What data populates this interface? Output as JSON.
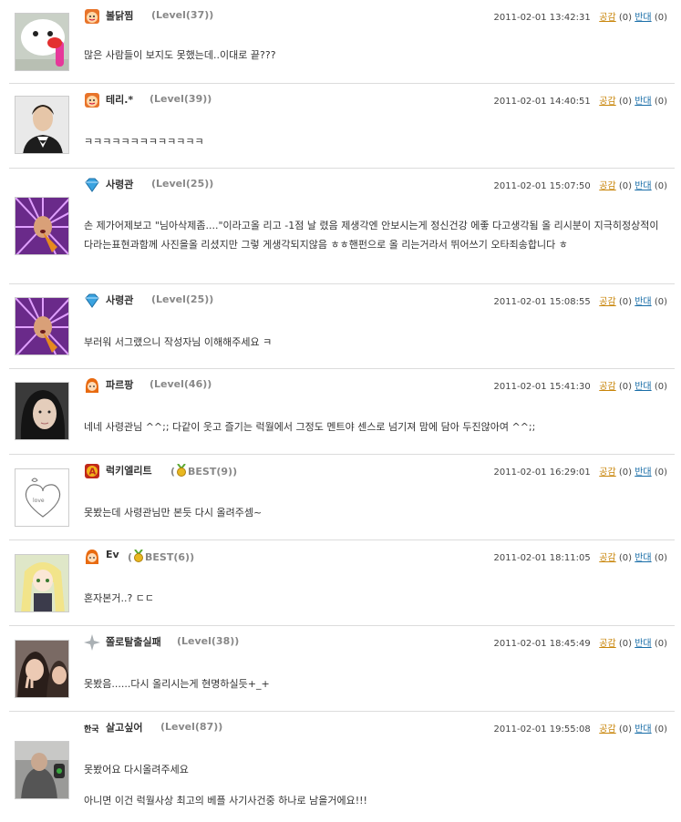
{
  "labels": {
    "agree": "공감",
    "oppose": "반대"
  },
  "comments": [
    {
      "nick": "볼닭찜",
      "level": "(Level(37))",
      "time": "2011-02-01 13:42:31",
      "agree_count": "(0)",
      "oppose_count": "(0)",
      "text": "많은 사람들이 보지도 못했는데..이대로 끝???",
      "level_icon": "orange-face-icon",
      "avatar": "white-ghost-avatar"
    },
    {
      "nick": "테리.*",
      "level": "(Level(39))",
      "time": "2011-02-01 14:40:51",
      "agree_count": "(0)",
      "oppose_count": "(0)",
      "text": "ㅋㅋㅋㅋㅋㅋㅋㅋㅋㅋㅋㅋㅋ",
      "level_icon": "orange-face-icon",
      "avatar": "man-in-suit-avatar"
    },
    {
      "nick": "사령관",
      "level": "(Level(25))",
      "time": "2011-02-01 15:07:50",
      "agree_count": "(0)",
      "oppose_count": "(0)",
      "text": "손 제가어제보고 \"님아삭제좀....\"이라고올 리고 -1점 날 렸음 제생각엔 안보시는게 정신건강 에좋 다고생각됨 올 리시분이 지극히정상적이다라는표현과함께 사진을올 리셨지만 그렇 게생각되지않음 ㅎㅎ핸펀으로 올 리는거라서 뛰어쓰기 오타죄송합니다 ㅎ",
      "level_icon": "blue-diamond-icon",
      "avatar": "purple-burst-avatar"
    },
    {
      "nick": "사령관",
      "level": "(Level(25))",
      "time": "2011-02-01 15:08:55",
      "agree_count": "(0)",
      "oppose_count": "(0)",
      "text": "부러워 서그랬으니 작성자님 이해해주세요 ㅋ",
      "level_icon": "blue-diamond-icon",
      "avatar": "purple-burst-avatar"
    },
    {
      "nick": "파르팡",
      "level": "(Level(46))",
      "time": "2011-02-01 15:41:30",
      "agree_count": "(0)",
      "oppose_count": "(0)",
      "text": "네네 사령관님 ^^;; 다같이 웃고 즐기는 럭월에서 그정도 멘트야 센스로 넘기져 맘에 담아 두진않아여 ^^;;",
      "level_icon": "orange-hair-face-icon",
      "avatar": "woman-face-avatar"
    },
    {
      "nick": "럭키엘리트",
      "level": "BEST(9))",
      "time": "2011-02-01 16:29:01",
      "agree_count": "(0)",
      "oppose_count": "(0)",
      "text": "못봤는데 사령관님만 본듯 다시 올려주셈~",
      "level_icon": "red-a-badge-icon",
      "avatar": "heart-sketch-avatar",
      "best": true
    },
    {
      "nick": "Ev",
      "level": "BEST(6))",
      "time": "2011-02-01 18:11:05",
      "agree_count": "(0)",
      "oppose_count": "(0)",
      "text": "혼자본거..? ㄷㄷ",
      "level_icon": "orange-hair-face-icon",
      "avatar": "anime-girl-avatar",
      "best": true
    },
    {
      "nick": "쫄로탈출실패",
      "level": "(Level(38))",
      "time": "2011-02-01 18:45:49",
      "agree_count": "(0)",
      "oppose_count": "(0)",
      "text": "못봤음......다시 올리시는게 현명하실듯+_+",
      "level_icon": "gray-star-icon",
      "avatar": "girls-peace-avatar"
    },
    {
      "nick": "살고싶어",
      "level": "(Level(87))",
      "time": "2011-02-01 19:55:08",
      "agree_count": "(0)",
      "oppose_count": "(0)",
      "text": "못봤어요 다시올려주세요",
      "text2": "아니면 이건 럭월사상 최고의 베플 사기사건중 하나로 남을거에요!!!",
      "level_icon": "hanguk-text-icon",
      "avatar": "man-crouching-avatar"
    }
  ]
}
